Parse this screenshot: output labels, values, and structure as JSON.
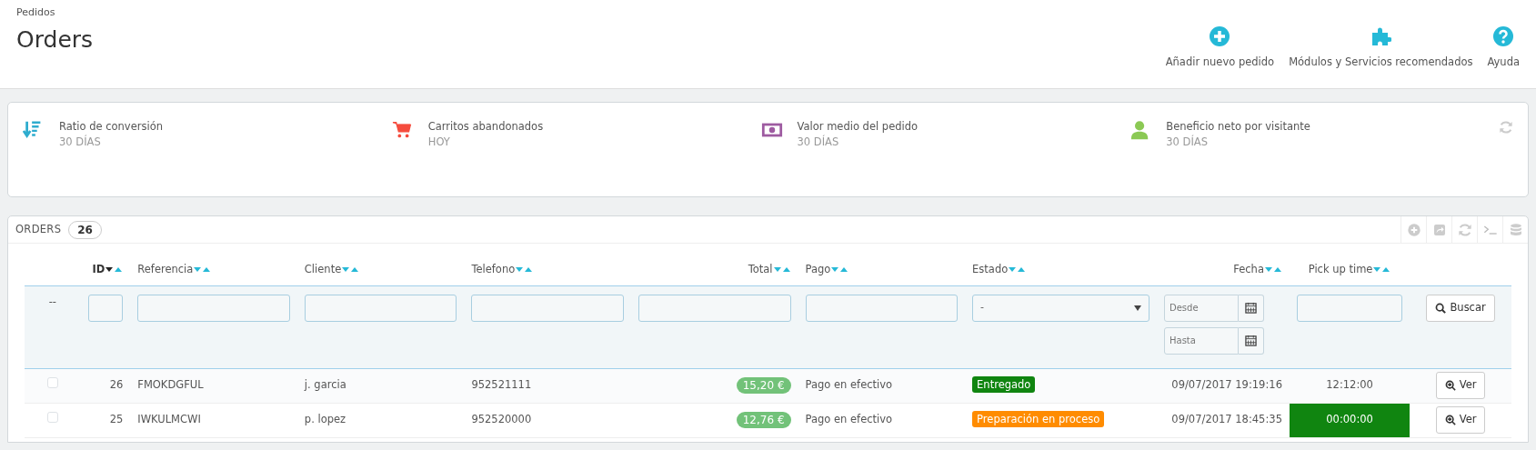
{
  "header": {
    "breadcrumb": "Pedidos",
    "title": "Orders",
    "toolbar": [
      {
        "kind": "add",
        "label": "Añadir nuevo pedido"
      },
      {
        "kind": "modules",
        "label": "Módulos y Servicios recomendados"
      },
      {
        "kind": "help",
        "label": "Ayuda"
      }
    ]
  },
  "kpis": [
    {
      "kind": "conversion",
      "title": "Ratio de conversión",
      "period": "30 DÍAS"
    },
    {
      "kind": "cart",
      "title": "Carritos abandonados",
      "period": "HOY"
    },
    {
      "kind": "money",
      "title": "Valor medio del pedido",
      "period": "30 DÍAS"
    },
    {
      "kind": "visitor",
      "title": "Beneficio neto por visitante",
      "period": "30 DÍAS"
    }
  ],
  "orders_panel": {
    "title": "ORDERS",
    "count": "26"
  },
  "table": {
    "columns": [
      {
        "label": "ID",
        "sorted": true
      },
      {
        "label": "Referencia",
        "sorted": false
      },
      {
        "label": "Cliente",
        "sorted": false
      },
      {
        "label": "Telefono",
        "sorted": false
      },
      {
        "label": "Total",
        "sorted": false
      },
      {
        "label": "Pago",
        "sorted": false
      },
      {
        "label": "Estado",
        "sorted": false
      },
      {
        "label": "Fecha",
        "sorted": false
      },
      {
        "label": "Pick up time",
        "sorted": false
      }
    ],
    "filters": [
      {
        "kind": "none",
        "text": "--"
      },
      {
        "kind": "text"
      },
      {
        "kind": "text"
      },
      {
        "kind": "text"
      },
      {
        "kind": "text"
      },
      {
        "kind": "text"
      },
      {
        "kind": "text"
      },
      {
        "kind": "select",
        "value": "-"
      },
      {
        "kind": "daterange",
        "from_placeholder": "Desde",
        "to_placeholder": "Hasta"
      },
      {
        "kind": "text"
      },
      {
        "kind": "button",
        "label": "Buscar"
      }
    ],
    "rows": [
      {
        "checked": false,
        "id": "26",
        "reference": "FMOKDGFUL",
        "customer": "j. garcia",
        "phone": "952521111",
        "total": "15,20 €",
        "payment": "Pago en efectivo",
        "status": {
          "label": "Entregado",
          "color": "#108510"
        },
        "date": "09/07/2017 19:19:16",
        "pickup": {
          "text": "12:12:00",
          "highlighted": false
        },
        "action": "Ver"
      },
      {
        "checked": false,
        "id": "25",
        "reference": "IWKULMCWI",
        "customer": "p. lopez",
        "phone": "952520000",
        "total": "12,76 €",
        "payment": "Pago en efectivo",
        "status": {
          "label": "Preparación en proceso",
          "color": "#ff8c00"
        },
        "date": "09/07/2017 18:45:35",
        "pickup": {
          "text": "00:00:00",
          "highlighted": true
        },
        "action": "Ver"
      }
    ]
  }
}
